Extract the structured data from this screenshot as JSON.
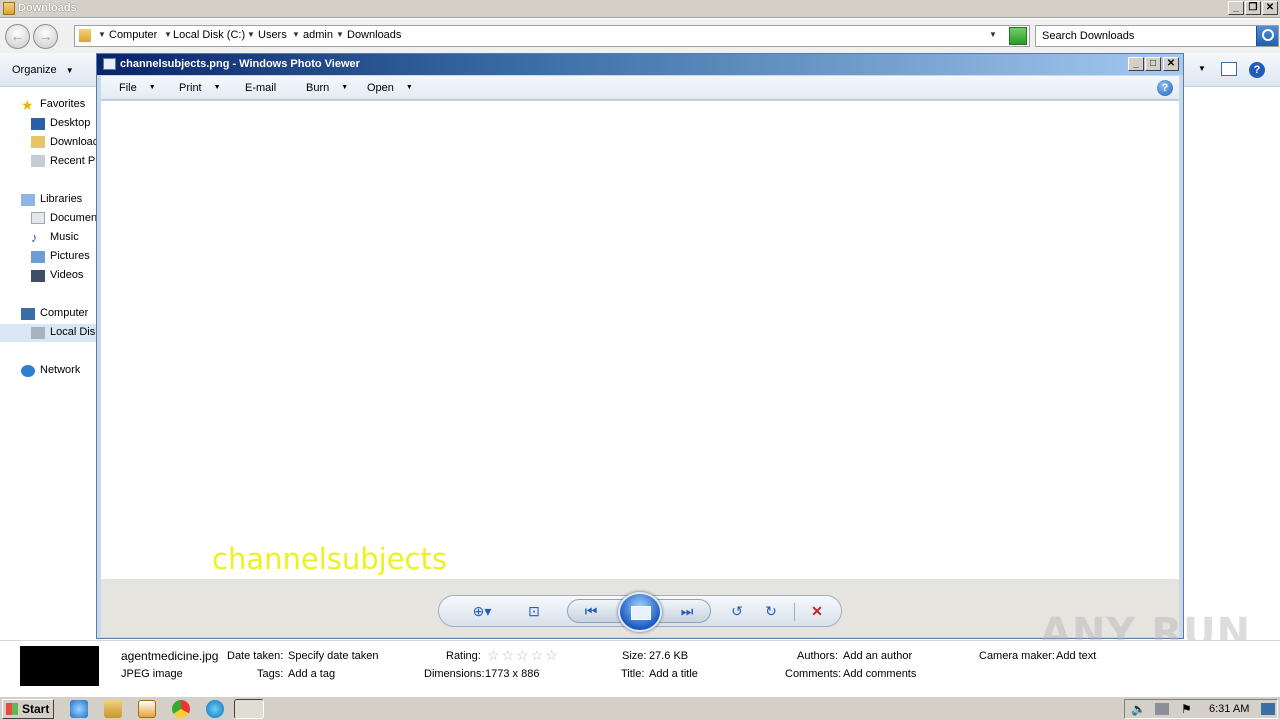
{
  "explorer": {
    "title": "Downloads",
    "breadcrumbs": [
      "Computer",
      "Local Disk (C:)",
      "Users",
      "admin",
      "Downloads"
    ],
    "search_placeholder": "Search Downloads",
    "organize_label": "Organize",
    "nav": {
      "favorites": "Favorites",
      "desktop": "Desktop",
      "downloads": "Downloac",
      "recent": "Recent Pl",
      "libraries": "Libraries",
      "documents": "Documen",
      "music": "Music",
      "pictures": "Pictures",
      "videos": "Videos",
      "computer": "Computer",
      "local_disk": "Local Disk",
      "network": "Network"
    }
  },
  "viewer": {
    "title": "channelsubjects.png - Windows Photo Viewer",
    "menu": {
      "file": "File",
      "print": "Print",
      "email": "E-mail",
      "burn": "Burn",
      "open": "Open"
    },
    "caption": "channelsubjects"
  },
  "details": {
    "file_name": "agentmedicine.jpg",
    "file_type": "JPEG image",
    "date_taken_label": "Date taken:",
    "date_taken_value": "Specify date taken",
    "tags_label": "Tags:",
    "tags_value": "Add a tag",
    "rating_label": "Rating:",
    "rating": 0,
    "dimensions_label": "Dimensions:",
    "dimensions_value": "1773 x 886",
    "size_label": "Size:",
    "size_value": "27.6 KB",
    "title_label": "Title:",
    "title_value": "Add a title",
    "authors_label": "Authors:",
    "authors_value": "Add an author",
    "comments_label": "Comments:",
    "comments_value": "Add comments",
    "camera_label": "Camera maker:",
    "camera_value": "Add text"
  },
  "taskbar": {
    "start_label": "Start",
    "clock": "6:31 AM"
  },
  "watermark": "ANY RUN"
}
